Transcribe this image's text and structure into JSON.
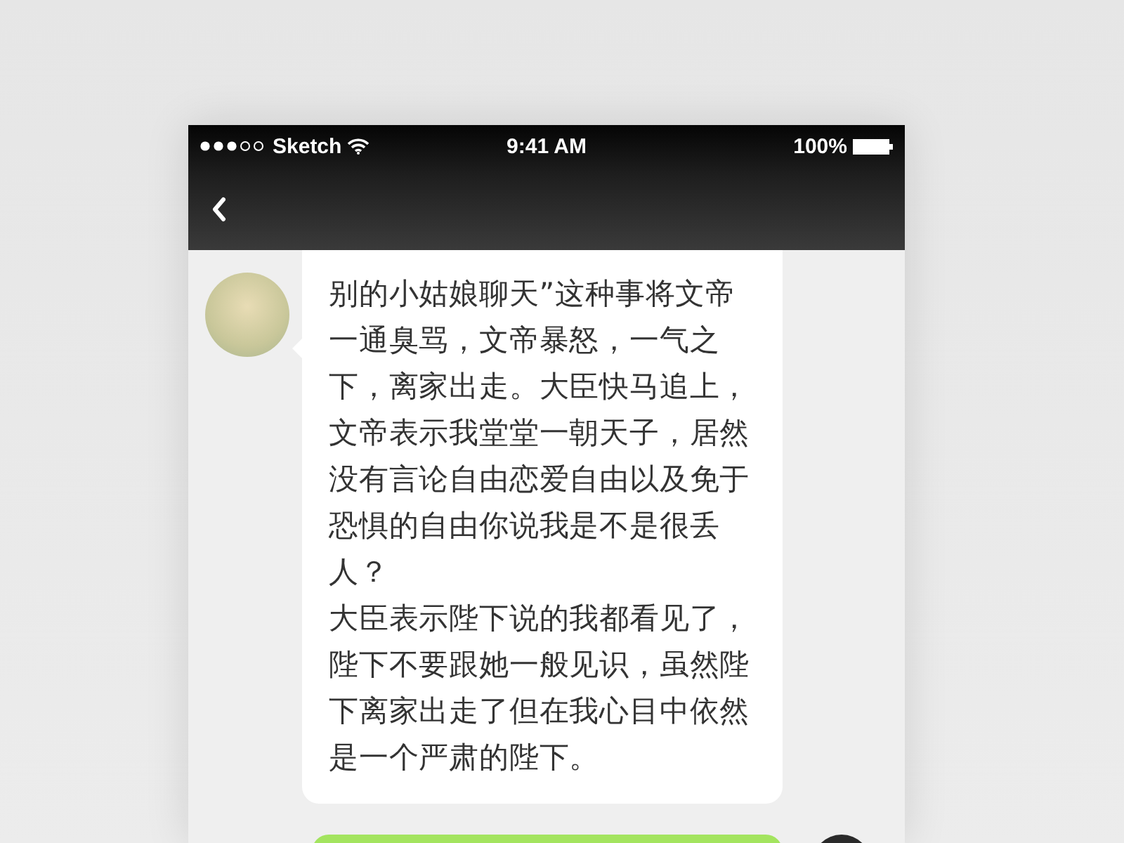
{
  "status_bar": {
    "carrier": "Sketch",
    "time": "9:41 AM",
    "battery": "100%"
  },
  "messages": [
    {
      "kind": "received",
      "paragraphs": [
        "别的小姑娘聊天”这种事将文帝一通臭骂，文帝暴怒，一气之下，离家出走。大臣快马追上，文帝表示我堂堂一朝天子，居然没有言论自由恋爱自由以及免于恐惧的自由你说我是不是很丢人？",
        "大臣表示陛下说的我都看见了，陛下不要跟她一般见识，虽然陛下离家出走了但在我心目中依然是一个严肃的陛下。"
      ]
    },
    {
      "kind": "sent"
    }
  ]
}
